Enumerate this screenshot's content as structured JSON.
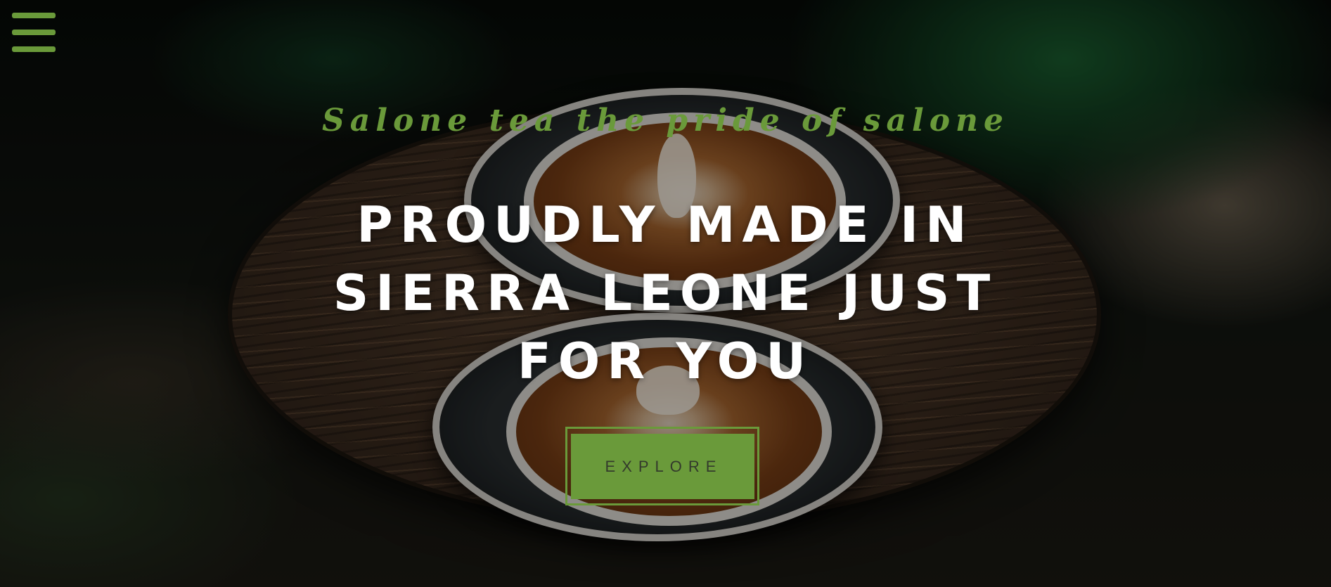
{
  "header": {
    "menu_icon": "hamburger-menu-icon"
  },
  "hero": {
    "tagline": "Salone tea the pride of salone",
    "headline": "PROUDLY MADE IN SIERRA LEONE JUST FOR YOU",
    "explore_label": "EXPLORE",
    "background_image": "coffee-cups-on-wooden-table"
  },
  "colors": {
    "accent": "#6a9a3a",
    "headline": "#ffffff",
    "button_text": "#333a2c"
  }
}
